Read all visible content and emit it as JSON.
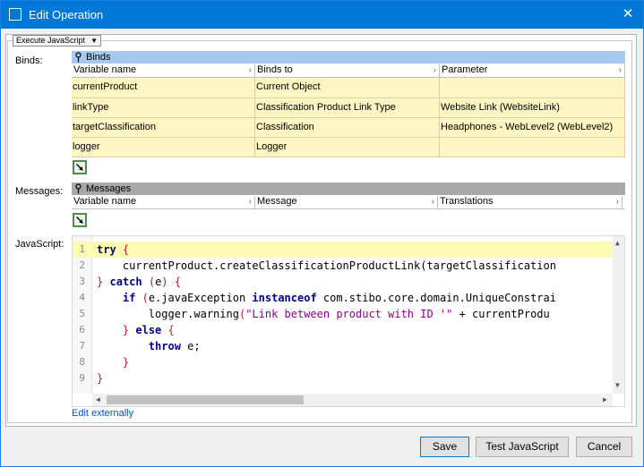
{
  "window": {
    "title": "Edit Operation"
  },
  "operation": {
    "selected": "Execute JavaScript"
  },
  "labels": {
    "binds": "Binds:",
    "messages": "Messages:",
    "javascript": "JavaScript:"
  },
  "binds": {
    "header": "Binds",
    "columns": [
      "Variable name",
      "Binds to",
      "Parameter"
    ],
    "rows": [
      [
        "currentProduct",
        "Current Object",
        ""
      ],
      [
        "linkType",
        "Classification Product Link Type",
        "Website Link (WebsiteLink)"
      ],
      [
        "targetClassification",
        "Classification",
        "Headphones - WebLevel2 (WebLevel2)"
      ],
      [
        "logger",
        "Logger",
        ""
      ]
    ]
  },
  "messages": {
    "header": "Messages",
    "columns": [
      "Variable name",
      "Message",
      "Translations"
    ]
  },
  "code": {
    "lines": [
      "try {",
      "    currentProduct.createClassificationProductLink(targetClassification",
      "} catch (e) {",
      "    if (e.javaException instanceof com.stibo.core.domain.UniqueConstrai",
      "        logger.warning(\"Link between product with ID '\" + currentProdu",
      "    } else {",
      "        throw e;",
      "    }",
      "}"
    ]
  },
  "links": {
    "edit_externally": "Edit externally"
  },
  "buttons": {
    "save": "Save",
    "test": "Test JavaScript",
    "cancel": "Cancel"
  }
}
